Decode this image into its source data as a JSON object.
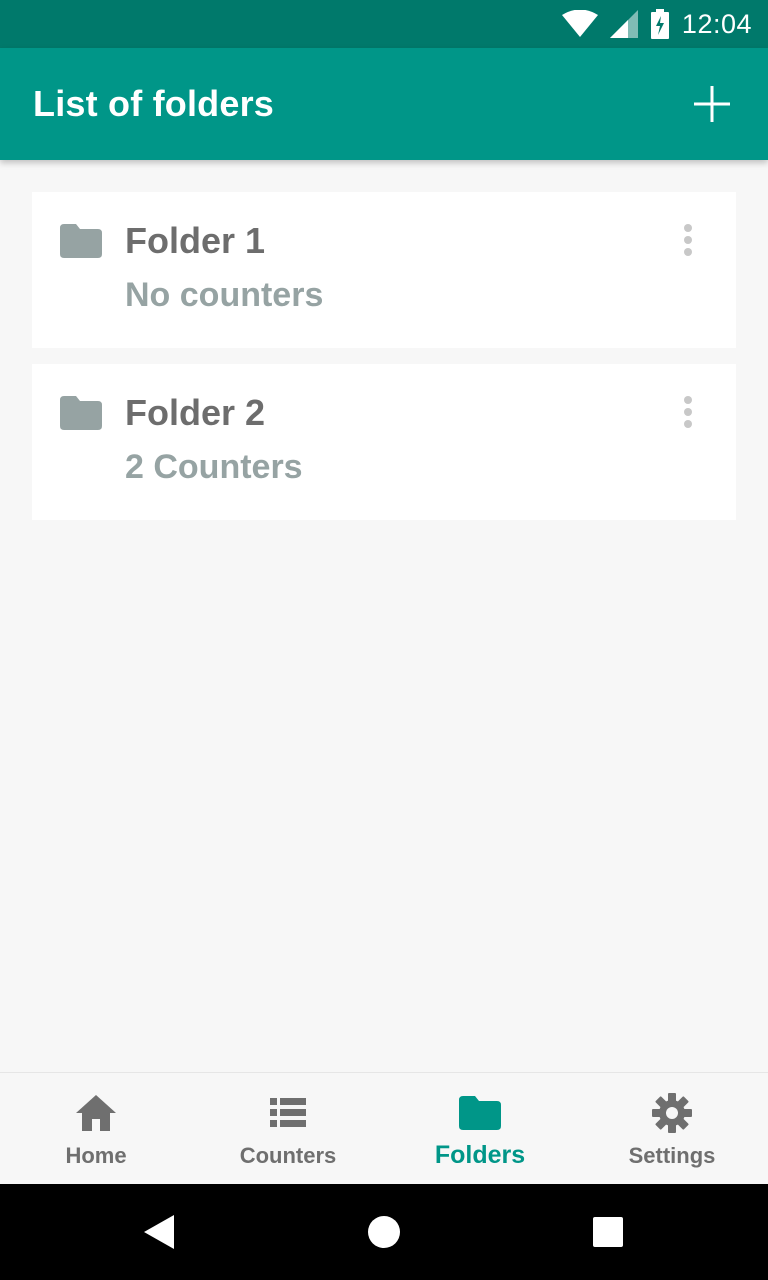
{
  "status_bar": {
    "time": "12:04",
    "icons": [
      "wifi-icon",
      "signal-icon",
      "battery-charging-icon"
    ]
  },
  "app_bar": {
    "title": "List of folders",
    "add_icon": "plus-icon"
  },
  "folders": [
    {
      "name": "Folder 1",
      "subtitle": "No counters",
      "icon": "folder-icon",
      "menu_icon": "more-vert-icon"
    },
    {
      "name": "Folder 2",
      "subtitle": "2 Counters",
      "icon": "folder-icon",
      "menu_icon": "more-vert-icon"
    }
  ],
  "bottom_nav": {
    "items": [
      {
        "label": "Home",
        "icon": "home-icon",
        "active": false
      },
      {
        "label": "Counters",
        "icon": "list-icon",
        "active": false
      },
      {
        "label": "Folders",
        "icon": "folder-icon",
        "active": true
      },
      {
        "label": "Settings",
        "icon": "gear-icon",
        "active": false
      }
    ]
  },
  "system_nav": {
    "icons": [
      "back-icon",
      "home-circle-icon",
      "recents-icon"
    ]
  },
  "colors": {
    "primary": "#009688",
    "primary_dark": "#00796b",
    "folder_icon": "#96a3a3",
    "title_text": "#6d6d6d",
    "subtitle_text": "#96a3a3"
  }
}
